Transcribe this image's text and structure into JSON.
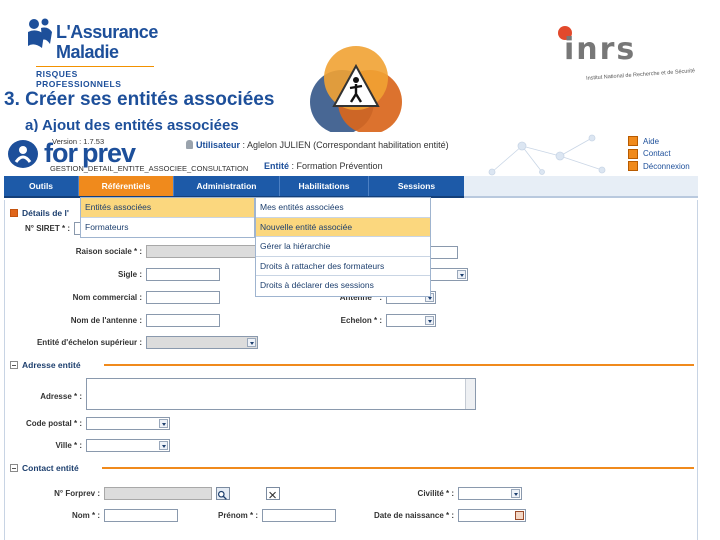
{
  "slide": {
    "title": "3. Créer ses entités associées",
    "subtitle": "a)   Ajout des entités associées",
    "logo_left": {
      "line1": "L'Assurance",
      "line2": "Maladie",
      "sub": "RISQUES PROFESSIONNELS"
    },
    "logo_right": {
      "word": "inrs",
      "tag": "Institut National de Recherche et de Sécurité"
    }
  },
  "app": {
    "brand_a": "for",
    "brand_b": "prev",
    "version": "Version : 1.7.53",
    "page_id": "GESTION_DETAIL_ENTITE_ASSOCIEE_CONSULTATION",
    "user_label": "Utilisateur",
    "user_value": ": Aglelon JULIEN (Correspondant habilitation entité)",
    "entity_label": "Entité",
    "entity_value": ": Formation Prévention",
    "links": [
      "Aide",
      "Contact",
      "Déconnexion"
    ],
    "nav": [
      {
        "label": "Outils"
      },
      {
        "label": "Référentiels"
      },
      {
        "label": "Administration"
      },
      {
        "label": "Habilitations"
      },
      {
        "label": "Sessions"
      }
    ],
    "menu_referentiels": [
      "Entités associées",
      "Formateurs"
    ],
    "menu_habilitations": [
      "Mes entités associées",
      "Nouvelle entité associée",
      "Gérer la hiérarchie",
      "Droits à rattacher des formateurs",
      "Droits à déclarer des sessions"
    ],
    "sections": {
      "details": "Détails de l'",
      "adresse": "Adresse entité",
      "contact": "Contact entité"
    },
    "labels": {
      "siret": "N° SIRET * :",
      "raison": "Raison sociale *  :",
      "sigle": "Sigle  :",
      "nom_commercial": "Nom commercial  :",
      "nom_antenne": "Nom de l'antenne  :",
      "antenne": "Antenne *  :",
      "echelon": "Echelon *  :",
      "entite_sup": "Entité d'échelon supérieur  :",
      "adresse": "Adresse *  :",
      "code_postal": "Code postal *  :",
      "ville": "Ville *  :",
      "forprev": "N° Forprev  :",
      "civilite": "Civilité *  :",
      "nom": "Nom *  :",
      "prenom": "Prénom *  :",
      "naissance": "Date de naissance *  :"
    }
  },
  "colors": {
    "brand_blue": "#1d4f9a",
    "accent_orange": "#f08a1c",
    "menu_highlight": "#fbd77e"
  }
}
